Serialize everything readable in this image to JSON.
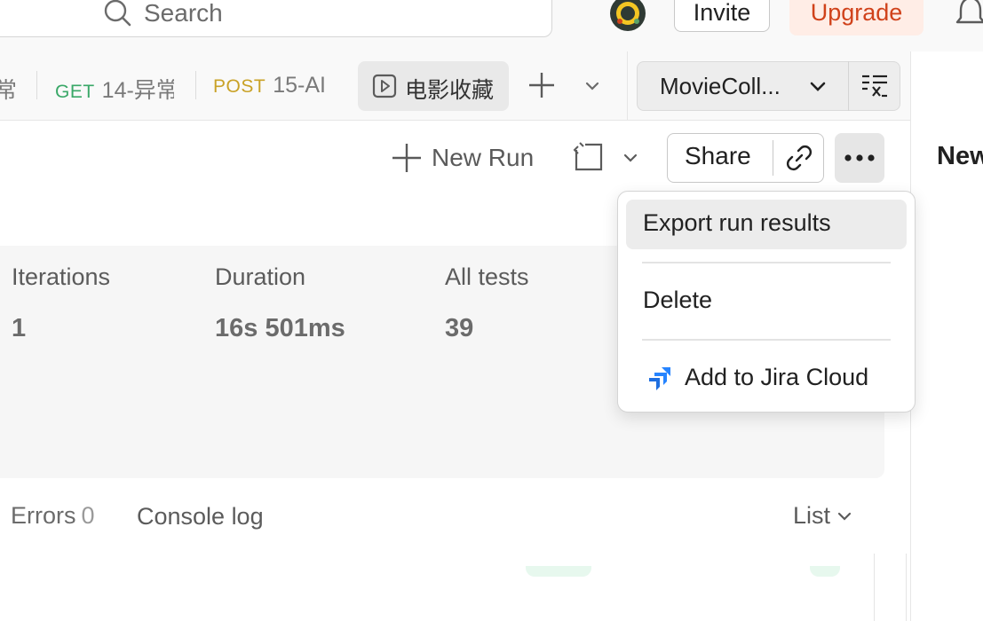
{
  "header": {
    "search_placeholder": "Search",
    "invite_label": "Invite",
    "upgrade_label": "Upgrade"
  },
  "tabs": [
    {
      "method": "",
      "name": "常"
    },
    {
      "method": "GET",
      "name": "14-异常"
    },
    {
      "method": "POST",
      "name": "15-AI"
    },
    {
      "method": "",
      "name": "电影收藏"
    }
  ],
  "environment": {
    "name": "MovieColl..."
  },
  "right_panel": {
    "title": "New"
  },
  "toolbar": {
    "new_run_label": "New Run",
    "share_label": "Share"
  },
  "summary": {
    "stats": [
      {
        "label": "Iterations",
        "value": "1"
      },
      {
        "label": "Duration",
        "value": "16s 501ms"
      },
      {
        "label": "All tests",
        "value": "39"
      }
    ]
  },
  "bottom_tabs": {
    "errors_label": "Errors",
    "errors_count": "0",
    "console_label": "Console log",
    "view_mode": "List"
  },
  "menu": {
    "items": [
      {
        "label": "Export run results",
        "highlighted": true
      },
      {
        "label": "Delete"
      },
      {
        "label": "Add to Jira Cloud",
        "icon": "jira-icon"
      }
    ]
  },
  "colors": {
    "get_method": "#3aa868",
    "post_method": "#c9a227",
    "upgrade_text": "#d0421b",
    "upgrade_bg": "#ffede6",
    "jira_blue": "#2684ff"
  }
}
